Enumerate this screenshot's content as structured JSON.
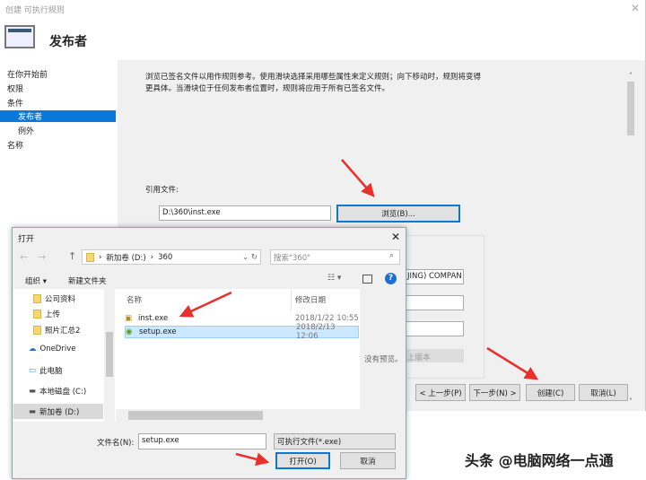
{
  "window": {
    "title": "创建 可执行规则",
    "close": "✕",
    "header_title": "发布者"
  },
  "nav": {
    "items": [
      {
        "label": "在你开始前"
      },
      {
        "label": "权限"
      },
      {
        "label": "条件"
      },
      {
        "label": "发布者"
      },
      {
        "label": "例外"
      },
      {
        "label": "名称"
      }
    ],
    "selected": "发布者"
  },
  "content": {
    "description": "浏览已签名文件以用作规则参考。使用滑块选择采用哪些属性来定义规则；向下移动时，规则将变得更具体。当滑块位于任何发布者位置时，规则将应用于所有已签名文件。",
    "ref_label": "引用文件:",
    "ref_value": "D:\\360\\inst.exe",
    "browse": "浏览(B)...",
    "publisher_value": "JING) COMPAN",
    "version_select": "上版本"
  },
  "footer": {
    "back": "< 上一步(P)",
    "next": "下一步(N) >",
    "create": "创建(C)",
    "cancel": "取消(L)"
  },
  "dialog": {
    "title": "打开",
    "close": "✕",
    "path": [
      "新加卷 (D:)",
      "360"
    ],
    "search_placeholder": "搜索\"360\"",
    "organize": "组织 ▾",
    "new_folder": "新建文件夹",
    "tree": [
      {
        "label": "公司资料"
      },
      {
        "label": "上传"
      },
      {
        "label": "照片汇总2"
      },
      {
        "label": "OneDrive"
      },
      {
        "label": "此电脑"
      },
      {
        "label": "本地磁盘 (C:)"
      },
      {
        "label": "新加卷 (D:)"
      }
    ],
    "columns": {
      "name": "名称",
      "date": "修改日期"
    },
    "files": [
      {
        "name": "inst.exe",
        "date": "2018/1/22 10:55"
      },
      {
        "name": "setup.exe",
        "date": "2018/2/13 12:06"
      }
    ],
    "no_preview": "没有预览。",
    "filename_label": "文件名(N):",
    "filename_value": "setup.exe",
    "filetype": "可执行文件(*.exe)",
    "open": "打开(O)",
    "cancel": "取消"
  },
  "watermark": "头条 @电脑网络一点通",
  "colors": {
    "accent": "#0a78d7",
    "arrow": "#e8312a",
    "selection": "#cce8ff"
  }
}
